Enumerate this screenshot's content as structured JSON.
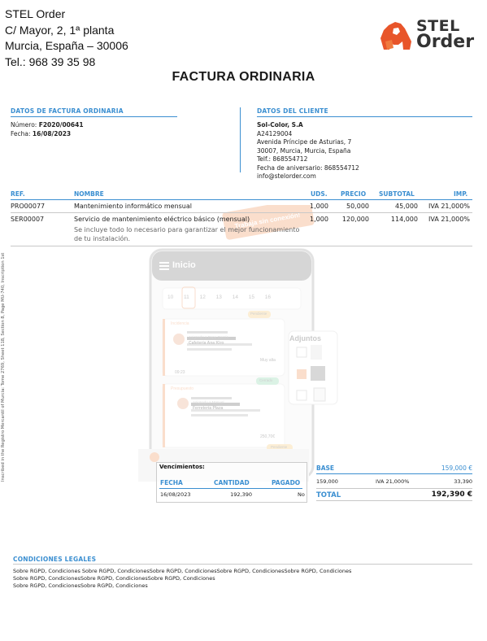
{
  "company": {
    "name": "STEL Order",
    "address1": "C/ Mayor, 2, 1ª planta",
    "address2": "Murcia, España – 30006",
    "phone": "Tel.: 968 39 35 98"
  },
  "logo": {
    "line1": "STEL",
    "line2": "Order",
    "color": "#e8552a"
  },
  "document_title": "FACTURA ORDINARIA",
  "invoice": {
    "heading": "DATOS DE FACTURA ORDINARIA",
    "number_label": "Número:",
    "number": "F2020/00641",
    "date_label": "Fecha:",
    "date": "16/08/2023"
  },
  "client": {
    "heading": "DATOS DEL CLIENTE",
    "name": "Sol-Color, S.A",
    "tax_id": "A24129004",
    "street": "Avenida Príncipe de Asturias, 7",
    "city": "30007, Murcia, Murcia, España",
    "phone": "Telf.: 868554712",
    "anniversary": "Fecha de aniversario: 868554712",
    "email": "info@stelorder.com"
  },
  "items_table": {
    "headers": {
      "ref": "REF.",
      "name": "NOMBRE",
      "units": "UDS.",
      "price": "PRECIO",
      "subtotal": "SUBTOTAL",
      "tax": "IMP."
    },
    "rows": [
      {
        "ref": "PRO00077",
        "name": "Mantenimiento informático mensual",
        "units": "1,000",
        "price": "50,000",
        "subtotal": "45,000",
        "tax": "IVA 21,000%",
        "note": ""
      },
      {
        "ref": "SER00007",
        "name": "Servicio de mantenimiento eléctrico básico (mensual)",
        "units": "1,000",
        "price": "120,000",
        "subtotal": "114,000",
        "tax": "IVA 21,000%",
        "note": "Se incluye todo lo necesario para garantizar el mejor funcionamiento de tu instalación."
      }
    ]
  },
  "side_text": "Inscribed in the Registro Mercantil of Murcia: Tome 2769, Sheet 118, Section 8, Page MU-740, Inscription 1st",
  "due_dates": {
    "title": "Vencimientos:",
    "headers": {
      "date": "FECHA",
      "amount": "CANTIDAD",
      "paid": "PAGADO"
    },
    "rows": [
      {
        "date": "16/08/2023",
        "amount": "192,390",
        "paid": "No"
      }
    ]
  },
  "totals": {
    "base_label": "BASE",
    "base_value": "159,000 €",
    "row": {
      "base": "159,000",
      "tax": "IVA 21,000%",
      "amount": "33,390"
    },
    "total_label": "TOTAL",
    "total_value": "192,390 €"
  },
  "legal": {
    "heading": "CONDICIONES LEGALES",
    "lines": [
      "Sobre RGPD, Condiciones Sobre RGPD, CondicionesSobre RGPD, CondicionesSobre RGPD, CondicionesSobre RGPD, Condiciones",
      "Sobre RGPD, CondicionesSobre RGPD, CondicionesSobre RGPD, Condiciones",
      "Sobre RGPD, CondicionesSobre RGPD, Condiciones"
    ]
  },
  "watermark": {
    "screen_title": "Inicio",
    "status_offline": "Trabaja sin conexión!",
    "attachments": "Adjuntos",
    "days": [
      "10",
      "11",
      "12",
      "13",
      "14",
      "15",
      "16"
    ],
    "card1": {
      "type": "Incidencia",
      "status": "Pendiente",
      "assignee": "Asignado a Pepe García",
      "client": "Cafetería Ana Kiro",
      "priority": "Muy alta",
      "time": "09:23"
    },
    "card2": {
      "type": "Presupuesto",
      "status": "Cerrado",
      "assignee": "Asignado a Manuel",
      "client": "Ferretería Plaza",
      "amount": "250,70€"
    },
    "status3": "Pendiente",
    "brand_color": "#f08a4b"
  }
}
